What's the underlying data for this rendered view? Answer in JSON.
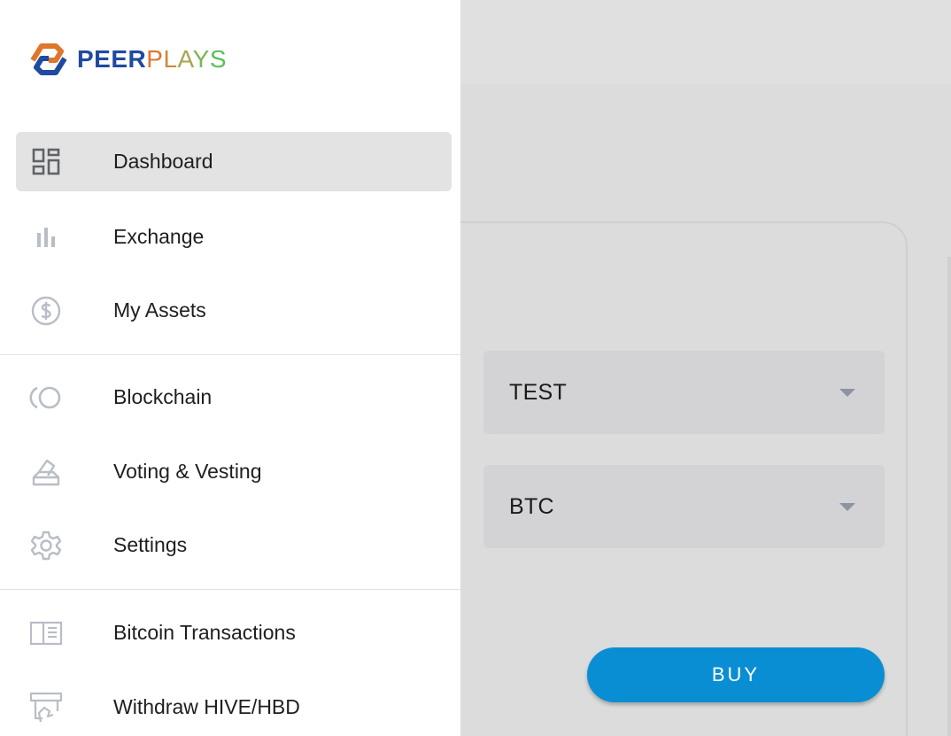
{
  "brand": {
    "name_part1": "PEER",
    "name_part2": [
      "P",
      "L",
      "A",
      "Y",
      "S"
    ]
  },
  "nav": {
    "items": [
      {
        "label": "Dashboard",
        "icon": "dashboard-icon",
        "active": true
      },
      {
        "label": "Exchange",
        "icon": "bar-chart-icon",
        "active": false
      },
      {
        "label": "My Assets",
        "icon": "dollar-circle-icon",
        "active": false
      },
      {
        "label": "Blockchain",
        "icon": "blockchain-icon",
        "active": false
      },
      {
        "label": "Voting & Vesting",
        "icon": "vote-icon",
        "active": false
      },
      {
        "label": "Settings",
        "icon": "gear-icon",
        "active": false
      },
      {
        "label": "Bitcoin Transactions",
        "icon": "book-icon",
        "active": false
      },
      {
        "label": "Withdraw HIVE/HBD",
        "icon": "withdraw-icon",
        "active": false
      }
    ]
  },
  "trade": {
    "asset_select": "TEST",
    "quote_select": "BTC",
    "buy_label": "BUY"
  },
  "colors": {
    "accent": "#0a8ed3",
    "brand_blue": "#1f4aa0",
    "brand_orange": "#e0762a",
    "brand_green": "#5bbd58",
    "icon_gray": "#8d93a0"
  }
}
